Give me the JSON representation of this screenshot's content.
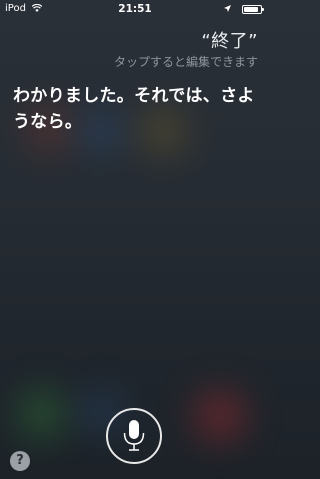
{
  "status_bar": {
    "carrier": "iPod",
    "time": "21:51",
    "wifi_icon": "wifi-icon",
    "location_icon": "location-arrow-icon",
    "battery_icon": "battery-icon",
    "battery_level": 0.9
  },
  "siri": {
    "query": "“終了”",
    "tap_hint": "タップすると編集できます",
    "reply": "わかりました。それでは、さようなら。"
  },
  "controls": {
    "mic_icon": "microphone-icon",
    "help_label": "?"
  }
}
